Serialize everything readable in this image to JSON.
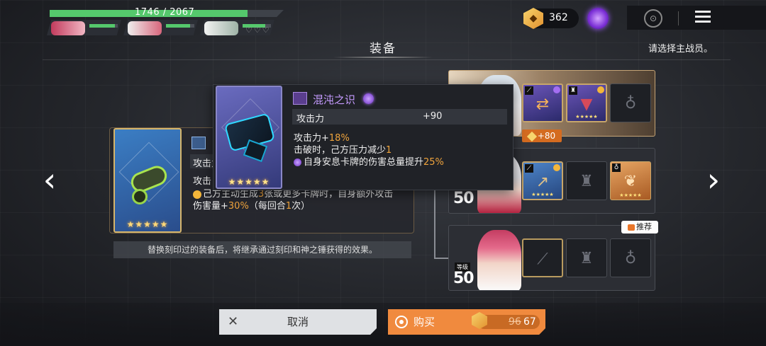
{
  "hud": {
    "hp_current": 1746,
    "hp_max": 2067,
    "hp_text": "1746 / 2067",
    "party": [
      {
        "name": "member-1",
        "hp_fraction": 0.9
      },
      {
        "name": "member-2",
        "hp_fraction": 0.85
      },
      {
        "name": "member-3",
        "hp_fraction": 0.8
      }
    ],
    "empty_hearts": "♡♡♡"
  },
  "topbar": {
    "currency_value": "362",
    "lock_icon": "lock-icon",
    "menu_icon": "hamburger-menu-icon"
  },
  "screen": {
    "title": "装备",
    "subtitle": "请选择主战员。"
  },
  "left_card": {
    "stars": "★★★★★",
    "row_label": "攻击力",
    "line1": "攻击",
    "line2_pre": "己方主动生成",
    "line2_num": "3",
    "line2_post": "张或更多卡牌时，自身额外攻击",
    "line3_pre": "伤害量+",
    "line3_num": "30%",
    "line3_post": "（每回合",
    "line3_num2": "1",
    "line3_end": "次）",
    "replace_note": "替换刻印过的装备后，将继承通过刻印和神之锤获得的效果。"
  },
  "tooltip": {
    "name": "混沌之识",
    "stat_name": "攻击力",
    "stat_value": "+90",
    "line1_pre": "攻击力+",
    "line1_num": "18%",
    "line2_pre": "击破时，己方压力减少",
    "line2_num": "1",
    "line3_pre": "自身安息卡牌的伤害总量提升",
    "line3_num": "25%",
    "stars": "★★★★★"
  },
  "characters": [
    {
      "level_label": "",
      "level": "",
      "bonus": "+80",
      "slot_stars": "★★★★★"
    },
    {
      "level_label": "",
      "level": "50",
      "slot_stars": "★★★★★"
    },
    {
      "level_label": "等级",
      "level": "50",
      "recommend": "推荐"
    }
  ],
  "actions": {
    "cancel_label": "取消",
    "buy_label": "购买",
    "price_old": "96",
    "price_new": "67"
  },
  "colors": {
    "accent_orange": "#f08a3e",
    "hp_green": "#55c86c",
    "rare_purple": "#c59bff",
    "highlight_number": "#f0a43c"
  }
}
